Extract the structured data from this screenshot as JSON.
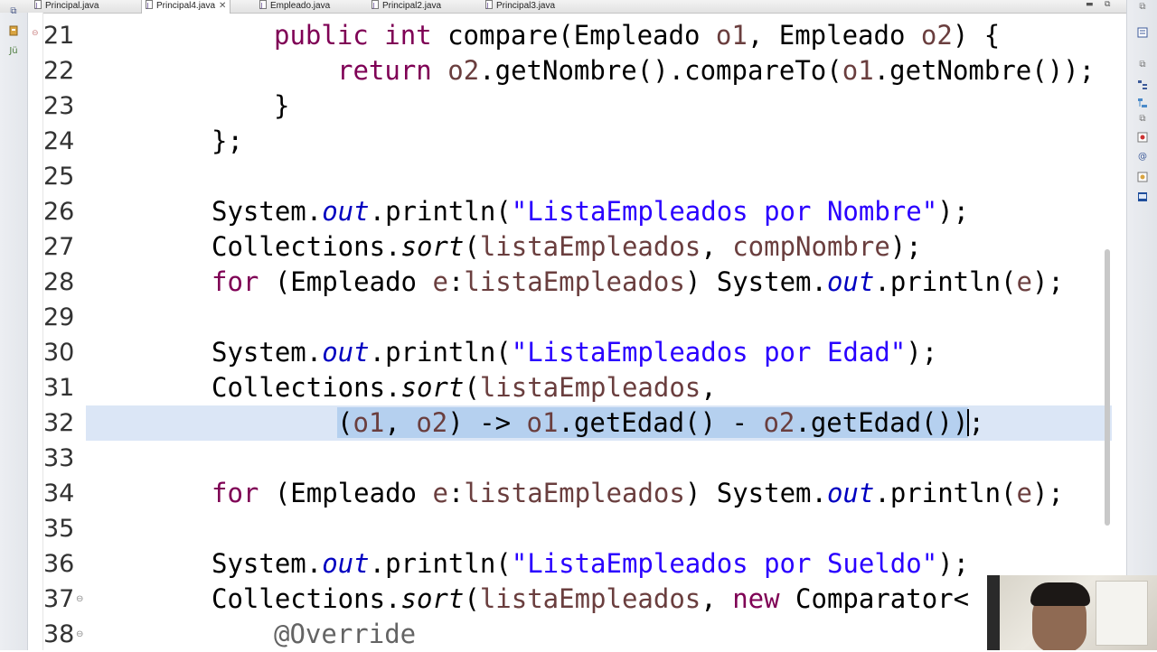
{
  "tabs": [
    {
      "label": "Principal.java",
      "active": false
    },
    {
      "label": "Principal4.java",
      "active": true
    },
    {
      "label": "Empleado.java",
      "active": false
    },
    {
      "label": "Principal2.java",
      "active": false
    },
    {
      "label": "Principal3.java",
      "active": false
    }
  ],
  "left_strip_icons": [
    "minimize-icon",
    "package-explorer-icon",
    "junit-icon"
  ],
  "right_strip_icons": [
    "minimize-icon",
    "task-list-icon",
    "minimize-icon",
    "outline-icon",
    "hierarchy-icon",
    "minimize-icon",
    "problems-icon",
    "javadoc-icon",
    "declaration-icon",
    "console-icon"
  ],
  "editor": {
    "font_colors": {
      "keyword": "#7f0055",
      "string": "#2a00ff",
      "field": "#0000c0",
      "selection": "#b5d0ef",
      "current_line": "#dbe6f6"
    },
    "lines": [
      {
        "n": "21",
        "tokens": [
          {
            "t": "public",
            "c": "kw"
          },
          {
            "t": " "
          },
          {
            "t": "int",
            "c": "kw"
          },
          {
            "t": " compare(Empleado "
          },
          {
            "t": "o1",
            "c": "var"
          },
          {
            "t": ", Empleado "
          },
          {
            "t": "o2",
            "c": "var"
          },
          {
            "t": ") {"
          }
        ]
      },
      {
        "n": "22",
        "tokens": [
          {
            "t": "return",
            "c": "kw"
          },
          {
            "t": " "
          },
          {
            "t": "o2",
            "c": "var"
          },
          {
            "t": ".getNombre().compareTo("
          },
          {
            "t": "o1",
            "c": "var"
          },
          {
            "t": ".getNombre());"
          }
        ]
      },
      {
        "n": "23",
        "tokens": [
          {
            "t": "}"
          }
        ]
      },
      {
        "n": "24",
        "tokens": [
          {
            "t": "};"
          }
        ]
      },
      {
        "n": "25",
        "tokens": []
      },
      {
        "n": "26",
        "tokens": [
          {
            "t": "System."
          },
          {
            "t": "out",
            "c": "fld"
          },
          {
            "t": ".println("
          },
          {
            "t": "\"ListaEmpleados por Nombre\"",
            "c": "str"
          },
          {
            "t": ");"
          }
        ]
      },
      {
        "n": "27",
        "tokens": [
          {
            "t": "Collections."
          },
          {
            "t": "sort",
            "c": "sm"
          },
          {
            "t": "("
          },
          {
            "t": "listaEmpleados",
            "c": "var"
          },
          {
            "t": ", "
          },
          {
            "t": "compNombre",
            "c": "var"
          },
          {
            "t": ");"
          }
        ]
      },
      {
        "n": "28",
        "tokens": [
          {
            "t": "for",
            "c": "kw"
          },
          {
            "t": " (Empleado "
          },
          {
            "t": "e",
            "c": "var"
          },
          {
            "t": ":"
          },
          {
            "t": "listaEmpleados",
            "c": "var"
          },
          {
            "t": ") System."
          },
          {
            "t": "out",
            "c": "fld"
          },
          {
            "t": ".println("
          },
          {
            "t": "e",
            "c": "var"
          },
          {
            "t": ");"
          }
        ]
      },
      {
        "n": "29",
        "tokens": []
      },
      {
        "n": "30",
        "tokens": [
          {
            "t": "System."
          },
          {
            "t": "out",
            "c": "fld"
          },
          {
            "t": ".println("
          },
          {
            "t": "\"ListaEmpleados por Edad\"",
            "c": "str"
          },
          {
            "t": ");"
          }
        ]
      },
      {
        "n": "31",
        "tokens": [
          {
            "t": "Collections."
          },
          {
            "t": "sort",
            "c": "sm"
          },
          {
            "t": "("
          },
          {
            "t": "listaEmpleados",
            "c": "var"
          },
          {
            "t": ","
          }
        ]
      },
      {
        "n": "32",
        "current": true,
        "tokens": [
          {
            "t": "(",
            "sel": true
          },
          {
            "t": "o1",
            "c": "var",
            "sel": true
          },
          {
            "t": ", ",
            "sel": true
          },
          {
            "t": "o2",
            "c": "var",
            "sel": true
          },
          {
            "t": ") -> ",
            "sel": true
          },
          {
            "t": "o1",
            "c": "var",
            "sel": true
          },
          {
            "t": ".getEdad() - ",
            "sel": true
          },
          {
            "t": "o2",
            "c": "var",
            "sel": true
          },
          {
            "t": ".getEdad())",
            "sel": true
          },
          {
            "caret": true
          },
          {
            "t": ";"
          }
        ]
      },
      {
        "n": "33",
        "tokens": []
      },
      {
        "n": "34",
        "tokens": [
          {
            "t": "for",
            "c": "kw"
          },
          {
            "t": " (Empleado "
          },
          {
            "t": "e",
            "c": "var"
          },
          {
            "t": ":"
          },
          {
            "t": "listaEmpleados",
            "c": "var"
          },
          {
            "t": ") System."
          },
          {
            "t": "out",
            "c": "fld"
          },
          {
            "t": ".println("
          },
          {
            "t": "e",
            "c": "var"
          },
          {
            "t": ");"
          }
        ]
      },
      {
        "n": "35",
        "tokens": []
      },
      {
        "n": "36",
        "tokens": [
          {
            "t": "System."
          },
          {
            "t": "out",
            "c": "fld"
          },
          {
            "t": ".println("
          },
          {
            "t": "\"ListaEmpleados por Sueldo\"",
            "c": "str"
          },
          {
            "t": ");"
          }
        ]
      },
      {
        "n": "37",
        "fold": true,
        "tokens": [
          {
            "t": "Collections."
          },
          {
            "t": "sort",
            "c": "sm"
          },
          {
            "t": "("
          },
          {
            "t": "listaEmpleados",
            "c": "var"
          },
          {
            "t": ", "
          },
          {
            "t": "new",
            "c": "kw"
          },
          {
            "t": " Comparator<"
          }
        ]
      },
      {
        "n": "38",
        "fold": true,
        "tokens": [
          {
            "t": "@Override",
            "c": "ann"
          }
        ]
      }
    ]
  }
}
